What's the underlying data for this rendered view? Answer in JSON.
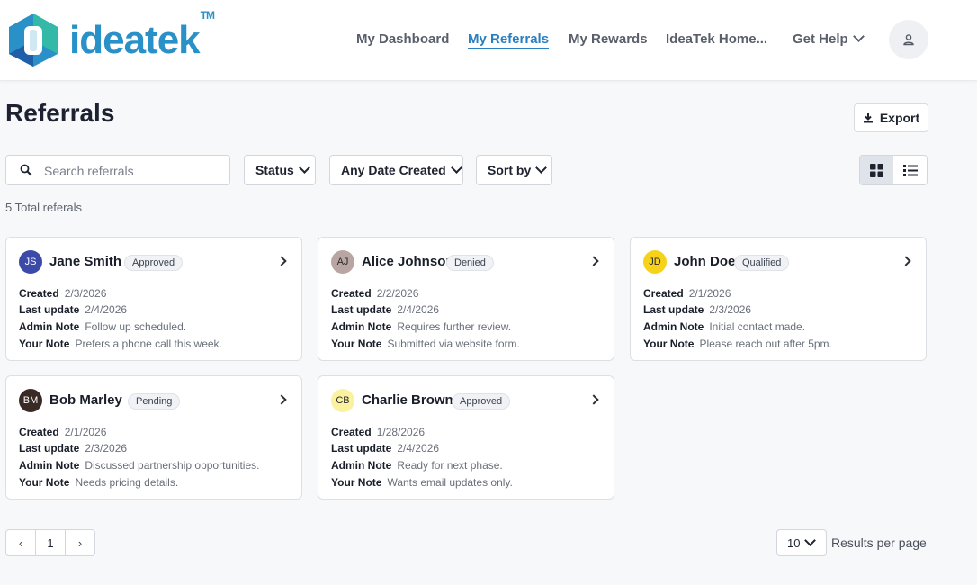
{
  "header": {
    "brand": "ideatek",
    "trademark": "TM",
    "nav": [
      "My Dashboard",
      "My Referrals",
      "My Rewards",
      "IdeaTek Home...",
      "Get Help"
    ],
    "active_nav": "My Referrals",
    "logo_colors": [
      "#2a90c8",
      "#34b9a8",
      "#1f5fa8"
    ]
  },
  "page": {
    "title": "Referrals",
    "export_label": "Export",
    "search_placeholder": "Search referrals",
    "filters": {
      "status": "Status",
      "date": "Any Date Created",
      "sort": "Sort by"
    },
    "view_mode": "grid",
    "total": "5 Total referals"
  },
  "labels": {
    "created": "Created",
    "last_update": "Last update",
    "admin_note": "Admin Note",
    "your_note": "Your Note"
  },
  "referrals": [
    {
      "initials": "JS",
      "name": "Jane Smith",
      "status": "Approved",
      "created": "2/3/2026",
      "last_update": "2/4/2026",
      "admin_note": "Follow up scheduled.",
      "your_note": "Prefers a phone call this week.",
      "avatar_bg": "#3b4aa8",
      "avatar_fg": "#ffffff"
    },
    {
      "initials": "AJ",
      "name": "Alice Johnson",
      "status": "Denied",
      "created": "2/2/2026",
      "last_update": "2/4/2026",
      "admin_note": "Requires further review.",
      "your_note": "Submitted via website form.",
      "avatar_bg": "#b9a6a2",
      "avatar_fg": "#2a2a2a"
    },
    {
      "initials": "JD",
      "name": "John Doe",
      "status": "Qualified",
      "created": "2/1/2026",
      "last_update": "2/3/2026",
      "admin_note": "Initial contact made.",
      "your_note": "Please reach out after 5pm.",
      "avatar_bg": "#f7d21a",
      "avatar_fg": "#2a2a2a"
    },
    {
      "initials": "BM",
      "name": "Bob Marley",
      "status": "Pending",
      "created": "2/1/2026",
      "last_update": "2/3/2026",
      "admin_note": "Discussed partnership opportunities.",
      "your_note": "Needs pricing details.",
      "avatar_bg": "#3a2a26",
      "avatar_fg": "#ffffff"
    },
    {
      "initials": "CB",
      "name": "Charlie Brown",
      "status": "Approved",
      "created": "1/28/2026",
      "last_update": "2/4/2026",
      "admin_note": "Ready for next phase.",
      "your_note": "Wants email updates only.",
      "avatar_bg": "#fbf2a0",
      "avatar_fg": "#2a2a2a"
    }
  ],
  "pagination": {
    "prev": "‹",
    "page": "1",
    "next": "›",
    "per_page": "10",
    "per_page_label": "Results per page"
  }
}
